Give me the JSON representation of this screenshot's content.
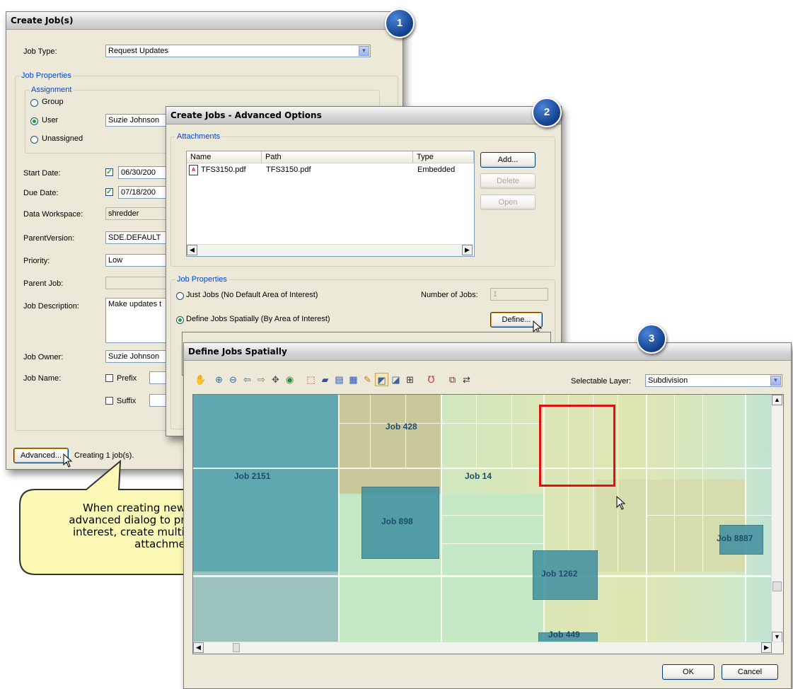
{
  "badges": {
    "b1": "1",
    "b2": "2",
    "b3": "3"
  },
  "create_jobs": {
    "title": "Create Job(s)",
    "job_type_label": "Job Type:",
    "job_type_value": "Request Updates",
    "job_properties_title": "Job Properties",
    "assignment_title": "Assignment",
    "assign_group": "Group",
    "assign_user": "User",
    "assign_unassigned": "Unassigned",
    "user_value": "Suzie Johnson",
    "start_date_label": "Start Date:",
    "start_date_value": "06/30/200",
    "due_date_label": "Due Date:",
    "due_date_value": "07/18/200",
    "data_workspace_label": "Data Workspace:",
    "data_workspace_value": "shredder",
    "parent_version_label": "ParentVersion:",
    "parent_version_value": "SDE.DEFAULT",
    "priority_label": "Priority:",
    "priority_value": "Low",
    "parent_job_label": "Parent Job:",
    "parent_job_value": "",
    "job_description_label": "Job Description:",
    "job_description_value": "Make updates t",
    "job_owner_label": "Job Owner:",
    "job_owner_value": "Suzie Johnson",
    "job_name_label": "Job Name:",
    "prefix_label": "Prefix",
    "suffix_label": "Suffix",
    "advanced_button": "Advanced...",
    "status_text": "Creating 1 job(s)."
  },
  "advanced_options": {
    "title": "Create Jobs - Advanced Options",
    "attachments_title": "Attachments",
    "columns": [
      "Name",
      "Path",
      "Type"
    ],
    "rows": [
      {
        "name": "TFS3150.pdf",
        "path": "TFS3150.pdf",
        "type": "Embedded"
      }
    ],
    "add_button": "Add...",
    "delete_button": "Delete",
    "open_button": "Open",
    "job_properties_title": "Job Properties",
    "just_jobs_label": "Just Jobs (No Default Area of Interest)",
    "number_of_jobs_label": "Number of Jobs:",
    "number_of_jobs_value": "1",
    "define_spatially_label": "Define Jobs Spatially (By Area of Interest)",
    "define_button": "Define..."
  },
  "define_jobs": {
    "title": "Define Jobs Spatially",
    "selectable_layer_label": "Selectable Layer:",
    "selectable_layer_value": "Subdivision",
    "jobs": [
      "Job 428",
      "Job 2151",
      "Job 14",
      "Job 898",
      "Job 8887",
      "Job 1262",
      "Job 449"
    ],
    "ok_button": "OK",
    "cancel_button": "Cancel"
  },
  "callout": {
    "text": "When creating new jobs, use the advanced dialog to predefine areas of interest, create multiple jobs, or add attachments."
  },
  "colors": {
    "accent_blue": "#0046d5",
    "selection_red": "#e01010",
    "job_teal": "#3f8fa0",
    "callout_yellow": "#fbf7b4"
  },
  "icons": [
    "dropdown-arrow-icon",
    "pdf-file-icon",
    "pointer-icon",
    "map-toolbar-icons"
  ]
}
